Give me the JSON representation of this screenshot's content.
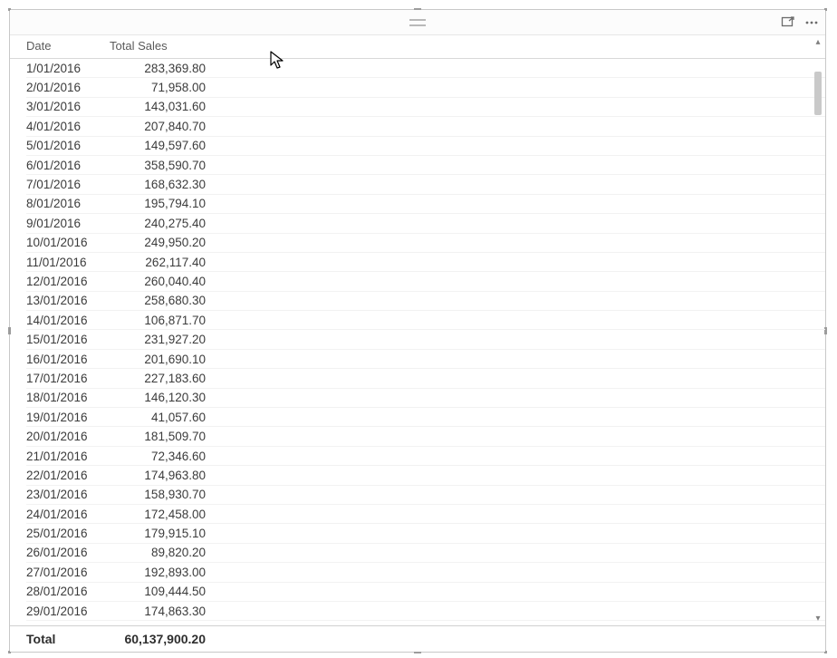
{
  "table": {
    "columns": [
      "Date",
      "Total Sales"
    ],
    "rows": [
      {
        "date": "1/01/2016",
        "sales": "283,369.80"
      },
      {
        "date": "2/01/2016",
        "sales": "71,958.00"
      },
      {
        "date": "3/01/2016",
        "sales": "143,031.60"
      },
      {
        "date": "4/01/2016",
        "sales": "207,840.70"
      },
      {
        "date": "5/01/2016",
        "sales": "149,597.60"
      },
      {
        "date": "6/01/2016",
        "sales": "358,590.70"
      },
      {
        "date": "7/01/2016",
        "sales": "168,632.30"
      },
      {
        "date": "8/01/2016",
        "sales": "195,794.10"
      },
      {
        "date": "9/01/2016",
        "sales": "240,275.40"
      },
      {
        "date": "10/01/2016",
        "sales": "249,950.20"
      },
      {
        "date": "11/01/2016",
        "sales": "262,117.40"
      },
      {
        "date": "12/01/2016",
        "sales": "260,040.40"
      },
      {
        "date": "13/01/2016",
        "sales": "258,680.30"
      },
      {
        "date": "14/01/2016",
        "sales": "106,871.70"
      },
      {
        "date": "15/01/2016",
        "sales": "231,927.20"
      },
      {
        "date": "16/01/2016",
        "sales": "201,690.10"
      },
      {
        "date": "17/01/2016",
        "sales": "227,183.60"
      },
      {
        "date": "18/01/2016",
        "sales": "146,120.30"
      },
      {
        "date": "19/01/2016",
        "sales": "41,057.60"
      },
      {
        "date": "20/01/2016",
        "sales": "181,509.70"
      },
      {
        "date": "21/01/2016",
        "sales": "72,346.60"
      },
      {
        "date": "22/01/2016",
        "sales": "174,963.80"
      },
      {
        "date": "23/01/2016",
        "sales": "158,930.70"
      },
      {
        "date": "24/01/2016",
        "sales": "172,458.00"
      },
      {
        "date": "25/01/2016",
        "sales": "179,915.10"
      },
      {
        "date": "26/01/2016",
        "sales": "89,820.20"
      },
      {
        "date": "27/01/2016",
        "sales": "192,893.00"
      },
      {
        "date": "28/01/2016",
        "sales": "109,444.50"
      },
      {
        "date": "29/01/2016",
        "sales": "174,863.30"
      }
    ],
    "total_label": "Total",
    "total_value": "60,137,900.20"
  },
  "chart_data": {
    "type": "table",
    "title": "",
    "columns": [
      "Date",
      "Total Sales"
    ],
    "rows": [
      [
        "1/01/2016",
        283369.8
      ],
      [
        "2/01/2016",
        71958.0
      ],
      [
        "3/01/2016",
        143031.6
      ],
      [
        "4/01/2016",
        207840.7
      ],
      [
        "5/01/2016",
        149597.6
      ],
      [
        "6/01/2016",
        358590.7
      ],
      [
        "7/01/2016",
        168632.3
      ],
      [
        "8/01/2016",
        195794.1
      ],
      [
        "9/01/2016",
        240275.4
      ],
      [
        "10/01/2016",
        249950.2
      ],
      [
        "11/01/2016",
        262117.4
      ],
      [
        "12/01/2016",
        260040.4
      ],
      [
        "13/01/2016",
        258680.3
      ],
      [
        "14/01/2016",
        106871.7
      ],
      [
        "15/01/2016",
        231927.2
      ],
      [
        "16/01/2016",
        201690.1
      ],
      [
        "17/01/2016",
        227183.6
      ],
      [
        "18/01/2016",
        146120.3
      ],
      [
        "19/01/2016",
        41057.6
      ],
      [
        "20/01/2016",
        181509.7
      ],
      [
        "21/01/2016",
        72346.6
      ],
      [
        "22/01/2016",
        174963.8
      ],
      [
        "23/01/2016",
        158930.7
      ],
      [
        "24/01/2016",
        172458.0
      ],
      [
        "25/01/2016",
        179915.1
      ],
      [
        "26/01/2016",
        89820.2
      ],
      [
        "27/01/2016",
        192893.0
      ],
      [
        "28/01/2016",
        109444.5
      ],
      [
        "29/01/2016",
        174863.3
      ]
    ],
    "total": 60137900.2
  }
}
